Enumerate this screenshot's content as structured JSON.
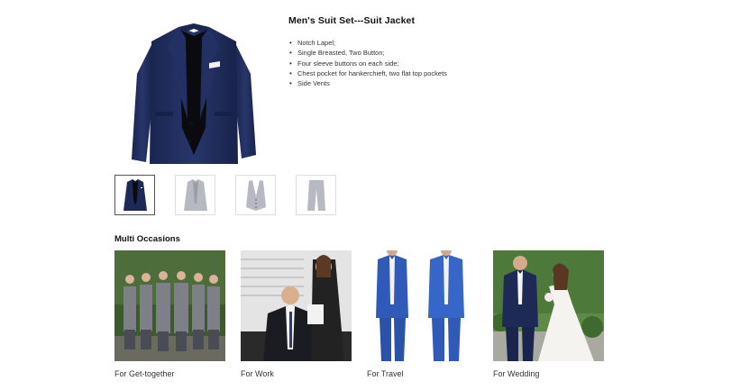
{
  "product": {
    "title": "Men's Suit Set---Suit Jacket",
    "features": [
      "Notch Lapel;",
      "Single Breasted, Two Button;",
      "Four sleeve buttons on each side;",
      "Chest pocket for hankerchieft, two flat top pockets",
      "Side Vents"
    ]
  },
  "thumbnails": [
    {
      "icon": "navy-jacket-icon",
      "color": "#1d2a55"
    },
    {
      "icon": "gray-jacket-icon",
      "color": "#b7b9c2"
    },
    {
      "icon": "gray-vest-icon",
      "color": "#b7b9c2"
    },
    {
      "icon": "gray-pants-icon",
      "color": "#b7b9c2"
    }
  ],
  "occasions": {
    "title": "Multi Occasions",
    "items": [
      {
        "label": "For Get-together"
      },
      {
        "label": "For Work"
      },
      {
        "label": "For Travel"
      },
      {
        "label": "For Wedding"
      }
    ]
  },
  "colors": {
    "navy": "#1d2a55",
    "jacket_gray": "#b7b9c2"
  }
}
